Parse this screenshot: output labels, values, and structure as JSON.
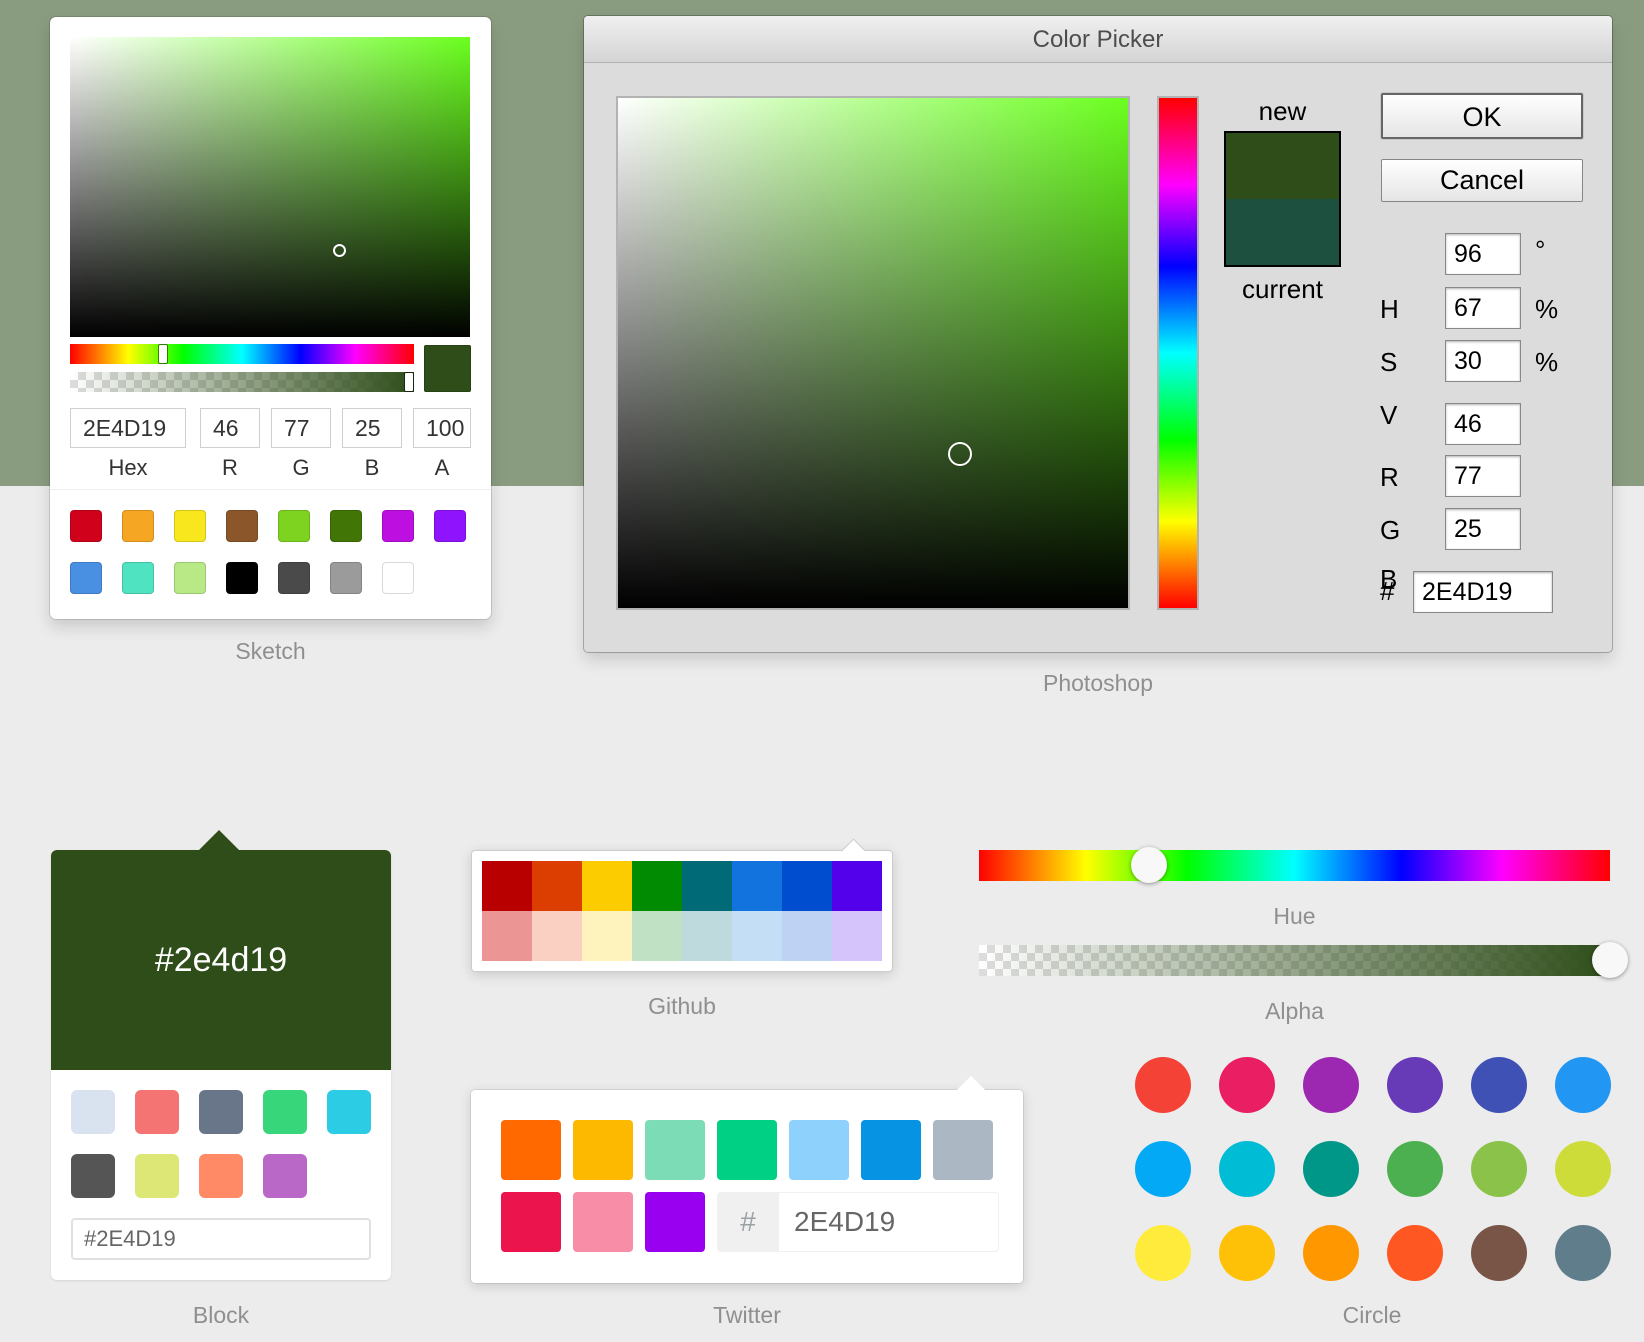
{
  "current_color": "#2E4D19",
  "current_color_lower": "#2e4d19",
  "background_band_color": "#8a9c80",
  "sketch": {
    "caption": "Sketch",
    "hex": "2E4D19",
    "r": "46",
    "g": "77",
    "b": "25",
    "a": "100",
    "labels": {
      "hex": "Hex",
      "r": "R",
      "g": "G",
      "b": "B",
      "a": "A"
    },
    "hue_position_fraction": 0.27,
    "alpha_fraction": 1.0,
    "presets": [
      "#D0021B",
      "#F5A623",
      "#F8E71C",
      "#8B572A",
      "#7ED321",
      "#417505",
      "#BD10E0",
      "#9013FE",
      "#4A90E2",
      "#50E3C2",
      "#B8E986",
      "#000000",
      "#4A4A4A",
      "#9B9B9B",
      "#FFFFFF"
    ]
  },
  "photoshop": {
    "title": "Color Picker",
    "caption": "Photoshop",
    "new_label": "new",
    "current_label": "current",
    "new_color": "#2E4D19",
    "current_color": "#1E5040",
    "ok_label": "OK",
    "cancel_label": "Cancel",
    "h_value": "96",
    "h_unit": "°",
    "s_value": "67",
    "s_unit": "%",
    "v_value": "30",
    "v_unit": "%",
    "r_value": "46",
    "g_value": "77",
    "b_value": "25",
    "hex_value": "2E4D19",
    "labels": {
      "h": "H",
      "s": "S",
      "v": "V",
      "r": "R",
      "g": "G",
      "b": "B",
      "hash": "#"
    }
  },
  "block": {
    "caption": "Block",
    "hex_display": "#2e4d19",
    "input_value": "#2E4D19",
    "swatches": [
      "#D9E3F0",
      "#F47373",
      "#697689",
      "#37D67A",
      "#2CCCE4",
      "#555555",
      "#DCE775",
      "#FF8A65",
      "#BA68C8"
    ]
  },
  "github": {
    "caption": "Github",
    "colors": [
      "#B80000",
      "#DB3E00",
      "#FCCB00",
      "#008B02",
      "#006B76",
      "#1273DE",
      "#004DCF",
      "#5300EB",
      "#EB9694",
      "#FAD0C3",
      "#FEF3BD",
      "#C1E1C5",
      "#BEDADC",
      "#C4DEF6",
      "#BED3F3",
      "#D4C4FB"
    ]
  },
  "hue_slider": {
    "caption": "Hue",
    "hue_fraction": 0.27
  },
  "alpha_slider": {
    "caption": "Alpha",
    "alpha_fraction": 1.0
  },
  "twitter": {
    "caption": "Twitter",
    "hash_label": "#",
    "input_value": "2E4D19",
    "swatches": [
      "#FF6900",
      "#FCB900",
      "#7BDCB5",
      "#00D084",
      "#8ED1FC",
      "#0693E3",
      "#ABB8C3",
      "#EB144C",
      "#F78DA7",
      "#9900EF"
    ]
  },
  "circle": {
    "caption": "Circle",
    "colors": [
      "#F44336",
      "#E91E63",
      "#9C27B0",
      "#673AB7",
      "#3F51B5",
      "#2196F3",
      "#03A9F4",
      "#00BCD4",
      "#009688",
      "#4CAF50",
      "#8BC34A",
      "#CDDC39",
      "#FFEB3B",
      "#FFC107",
      "#FF9800",
      "#FF5722",
      "#795548",
      "#607D8B"
    ]
  }
}
